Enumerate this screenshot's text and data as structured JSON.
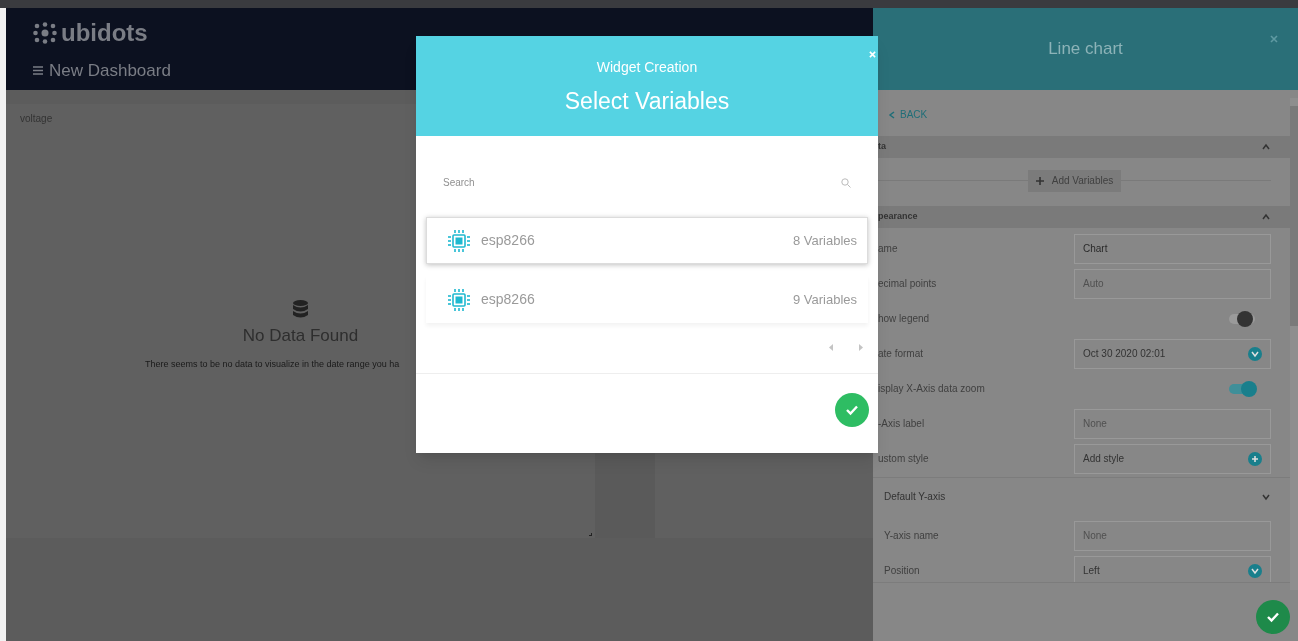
{
  "app": {
    "logo": "ubidots",
    "dashboard_title": "New Dashboard"
  },
  "widget": {
    "title": "voltage",
    "empty_title": "No Data Found",
    "empty_text": "There seems to be no data to visualize in the date range you ha"
  },
  "panel": {
    "title": "Line chart",
    "back": "BACK",
    "sections": [
      {
        "title": "ta",
        "expanded": true,
        "button": "Add Variables"
      },
      {
        "title": "pearance",
        "expanded": true,
        "rows": [
          {
            "label": "ame",
            "kind": "input",
            "value": "Chart"
          },
          {
            "label": "ecimal points",
            "kind": "input",
            "placeholder": "Auto"
          },
          {
            "label": "how legend",
            "kind": "toggle",
            "on": false
          },
          {
            "label": "ate format",
            "kind": "select",
            "value": "Oct 30 2020 02:01"
          },
          {
            "label": "isplay X-Axis data zoom",
            "kind": "toggle",
            "on": true
          },
          {
            "label": "-Axis label",
            "kind": "input",
            "placeholder": "None"
          },
          {
            "label": "ustom style",
            "kind": "action",
            "value": "Add style"
          }
        ]
      },
      {
        "title": "Default Y-axis",
        "expanded": false,
        "rows": [
          {
            "label": "Y-axis name",
            "kind": "input",
            "placeholder": "None"
          },
          {
            "label": "Position",
            "kind": "select",
            "value": "Left"
          }
        ]
      }
    ]
  },
  "modal": {
    "subtitle": "Widget Creation",
    "title": "Select Variables",
    "search": {
      "placeholder": "Search"
    },
    "devices": [
      {
        "name": "esp8266",
        "count": "8 Variables",
        "selected": true
      },
      {
        "name": "esp8266",
        "count": "9 Variables",
        "selected": false
      }
    ]
  }
}
